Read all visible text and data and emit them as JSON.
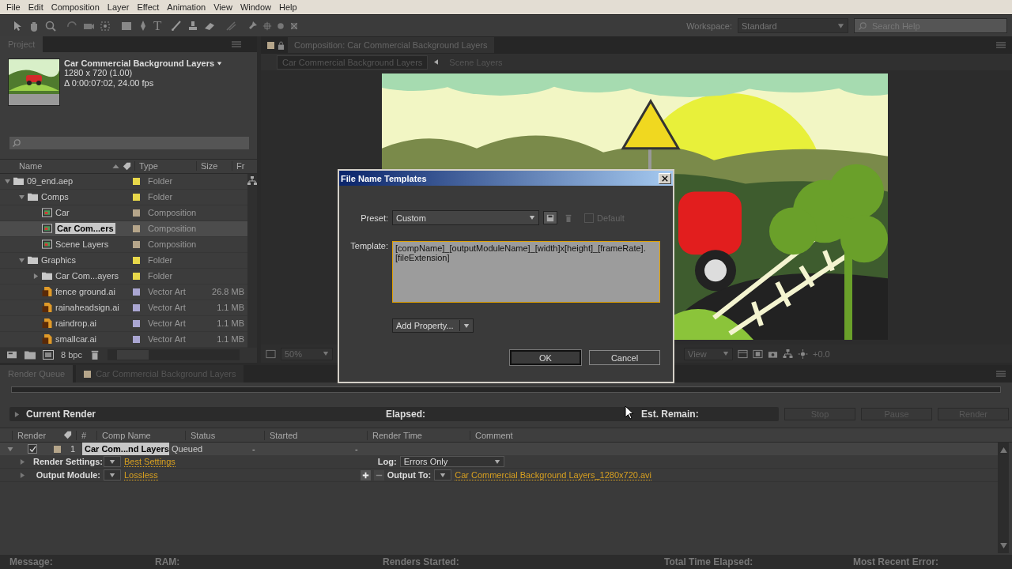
{
  "menu": [
    "File",
    "Edit",
    "Composition",
    "Layer",
    "Effect",
    "Animation",
    "View",
    "Window",
    "Help"
  ],
  "toolbar": {
    "type_tool": "T",
    "workspace_label": "Workspace:",
    "workspace": "Standard",
    "search_placeholder": "Search Help"
  },
  "project": {
    "tab": "Project",
    "comp_title": "Car Commercial Background Layers",
    "comp_size": "1280 x 720 (1.00)",
    "comp_duration": "Δ 0:00:07:02, 24.00 fps",
    "columns": [
      "Name",
      "Type",
      "Size",
      "Fr"
    ],
    "items": [
      {
        "kind": "folder",
        "name": "09_end.aep",
        "type": "Folder",
        "color": "#e8d84a",
        "expanded": true,
        "selected": false,
        "children": [
          {
            "kind": "folder",
            "name": "Comps",
            "type": "Folder",
            "color": "#e8d84a",
            "expanded": true,
            "selected": false,
            "children": [
              {
                "kind": "comp",
                "name": "Car",
                "type": "Composition",
                "color": "#b5a58a",
                "selected": false
              },
              {
                "kind": "comp",
                "name": "Car Com...ers",
                "type": "Composition",
                "color": "#b5a58a",
                "selected": true
              },
              {
                "kind": "comp",
                "name": "Scene Layers",
                "type": "Composition",
                "color": "#b5a58a",
                "selected": false
              }
            ]
          },
          {
            "kind": "folder",
            "name": "Graphics",
            "type": "Folder",
            "color": "#e8d84a",
            "expanded": true,
            "selected": false,
            "children": [
              {
                "kind": "folder",
                "name": "Car Com...ayers",
                "type": "Folder",
                "color": "#e8d84a",
                "expanded": false,
                "selected": false
              },
              {
                "kind": "ai",
                "name": "fence ground.ai",
                "type": "Vector Art",
                "size": "26.8 MB",
                "color": "#aaa6d2",
                "selected": false
              },
              {
                "kind": "ai",
                "name": "rainaheadsign.ai",
                "type": "Vector Art",
                "size": "1.1 MB",
                "color": "#aaa6d2",
                "selected": false
              },
              {
                "kind": "ai",
                "name": "raindrop.ai",
                "type": "Vector Art",
                "size": "1.1 MB",
                "color": "#aaa6d2",
                "selected": false
              },
              {
                "kind": "ai",
                "name": "smallcar.ai",
                "type": "Vector Art",
                "size": "1.1 MB",
                "color": "#aaa6d2",
                "selected": false
              }
            ]
          }
        ]
      }
    ],
    "bit_depth": "8 bpc"
  },
  "composition": {
    "tab": "Composition: Car Commercial Background Layers",
    "color": "#b5a58a",
    "breadcrumbs": [
      {
        "label": "Car Commercial Background Layers",
        "selected": true
      },
      {
        "label": "Scene Layers",
        "selected": false
      }
    ],
    "zoom": "50%",
    "view": "View",
    "exposure": "+0.0"
  },
  "render_queue": {
    "tabs": [
      {
        "label": "Render Queue",
        "selected": true
      },
      {
        "label": "Car Commercial Background Layers",
        "selected": false,
        "color": "#b5a58a"
      }
    ],
    "progress": {
      "level": 0
    },
    "current_render": "Current Render",
    "elapsed": "Elapsed:",
    "est_remain": "Est. Remain:",
    "buttons": [
      {
        "label": "Stop",
        "disabled": true
      },
      {
        "label": "Pause",
        "disabled": true
      },
      {
        "label": "Render",
        "disabled": true
      }
    ],
    "columns": [
      "Render",
      "#",
      "Comp Name",
      "Status",
      "Started",
      "Render Time",
      "Comment"
    ],
    "items": [
      {
        "checked": true,
        "color": "#b5a58a",
        "number": "1",
        "comp_name": "Car Com...nd Layers",
        "status": "Queued",
        "started": "-",
        "render_time": "-",
        "expanded": true,
        "render_settings_label": "Render Settings:",
        "render_settings": "Best Settings",
        "log_label": "Log:",
        "log": "Errors Only",
        "output_module_label": "Output Module:",
        "output_module": "Lossless",
        "output_to_label": "Output To:",
        "output_to": "Car Commercial Background Layers_1280x720.avi"
      }
    ],
    "status_bar": [
      "Message:",
      "RAM:",
      "Renders Started:",
      "Total Time Elapsed:",
      "Most Recent Error:"
    ]
  },
  "dialog": {
    "title": "File Name Templates",
    "preset_label": "Preset:",
    "preset": "Custom",
    "default": {
      "label": "Default",
      "checked": false,
      "disabled": true
    },
    "template_label": "Template:",
    "template": "[compName]_[outputModuleName]_[width]x[height]_[frameRate].[fileExtension]",
    "add_property": "Add Property...",
    "buttons": [
      "OK",
      "Cancel"
    ]
  }
}
